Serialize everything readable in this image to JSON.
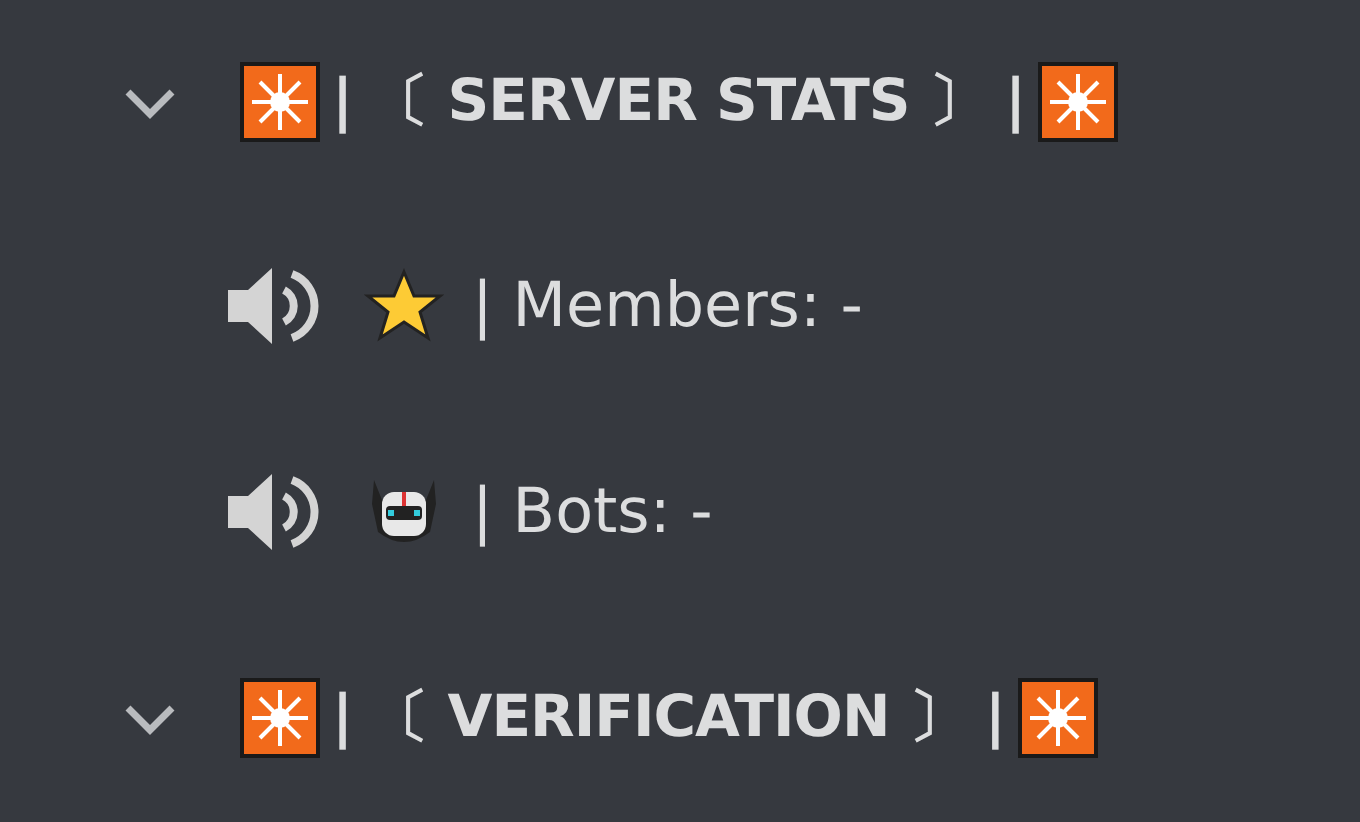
{
  "categories": [
    {
      "name": "| 〔 SERVER STATS 〕 |",
      "expanded": true,
      "channels": [
        {
          "kind": "star",
          "name": "| Members: -"
        },
        {
          "kind": "robot",
          "name": "| Bots: -"
        }
      ]
    },
    {
      "name": "| 〔 VERIFICATION 〕 |",
      "expanded": true
    }
  ]
}
